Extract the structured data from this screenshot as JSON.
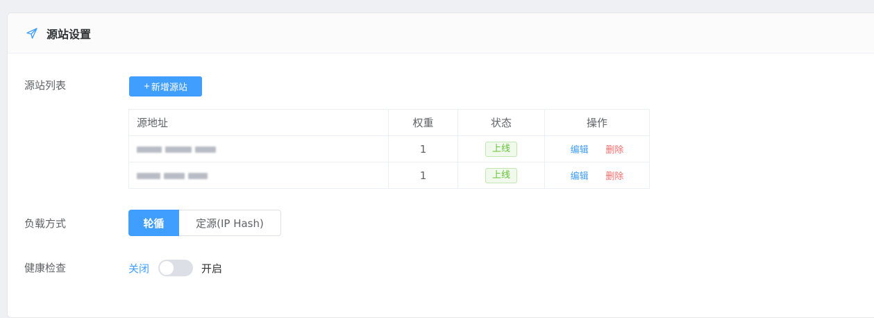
{
  "header": {
    "title": "源站设置",
    "icon": "navigation-icon"
  },
  "origins": {
    "label": "源站列表",
    "add_button": "新增源站",
    "columns": [
      "源地址",
      "权重",
      "状态",
      "操作"
    ],
    "rows": [
      {
        "weight": "1",
        "status": "上线",
        "edit": "编辑",
        "delete": "删除"
      },
      {
        "weight": "1",
        "status": "上线",
        "edit": "编辑",
        "delete": "删除"
      }
    ]
  },
  "load_balance": {
    "label": "负载方式",
    "options": [
      "轮循",
      "定源(IP Hash)"
    ],
    "selected": "轮循"
  },
  "health_check": {
    "label": "健康检查",
    "off_label": "关闭",
    "on_label": "开启",
    "enabled": false
  },
  "colors": {
    "primary": "#409eff",
    "success": "#67c23a",
    "danger": "#f56c6c"
  }
}
